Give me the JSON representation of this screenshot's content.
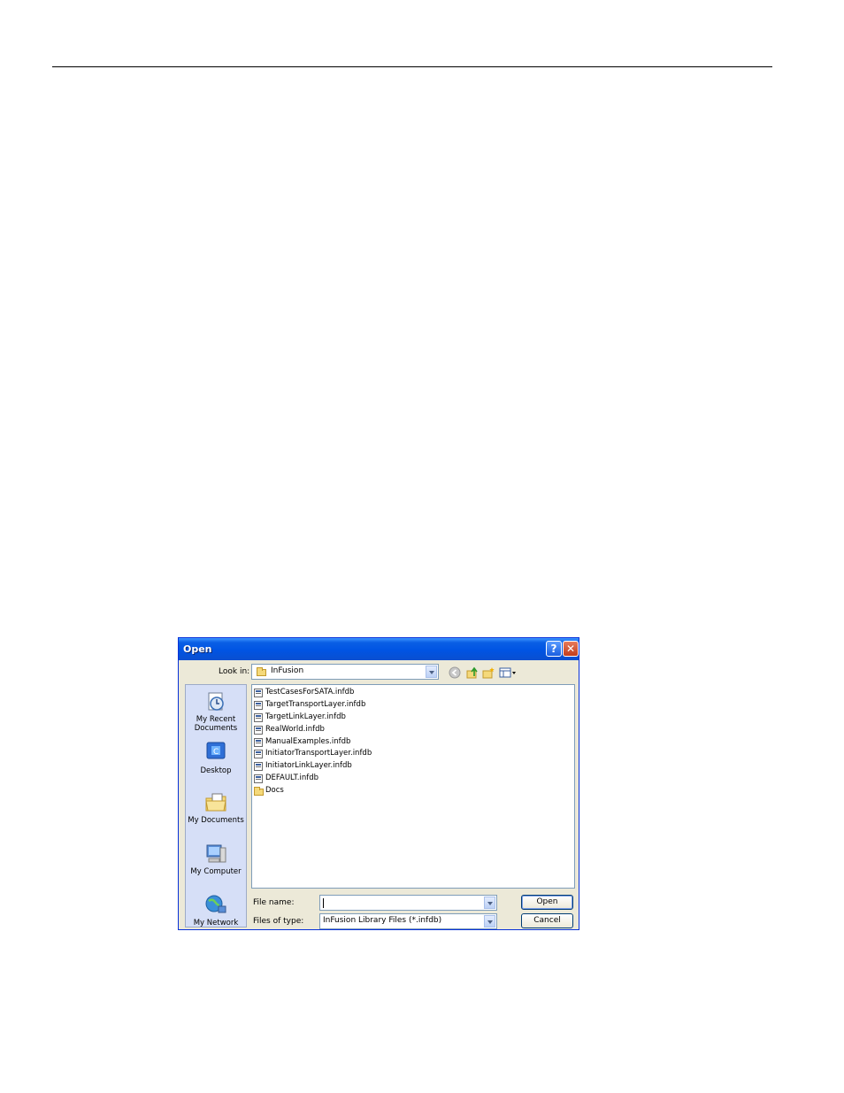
{
  "dialog": {
    "title": "Open",
    "help_label": "?",
    "close_label": "✕"
  },
  "lookin": {
    "label": "Look in:",
    "value": "InFusion"
  },
  "toolbar": {
    "icons": [
      "back-icon",
      "up-folder-icon",
      "new-folder-icon",
      "views-menu-icon"
    ]
  },
  "places": [
    {
      "label": "My Recent\nDocuments",
      "icon": "recent-documents-icon"
    },
    {
      "label": "Desktop",
      "icon": "desktop-icon"
    },
    {
      "label": "My Documents",
      "icon": "my-documents-icon"
    },
    {
      "label": "My Computer",
      "icon": "my-computer-icon"
    },
    {
      "label": "My Network",
      "icon": "my-network-icon"
    }
  ],
  "files": [
    {
      "name": "TestCasesForSATA.infdb",
      "type": "file"
    },
    {
      "name": "TargetTransportLayer.infdb",
      "type": "file"
    },
    {
      "name": "TargetLinkLayer.infdb",
      "type": "file"
    },
    {
      "name": "RealWorld.infdb",
      "type": "file"
    },
    {
      "name": "ManualExamples.infdb",
      "type": "file"
    },
    {
      "name": "InitiatorTransportLayer.infdb",
      "type": "file"
    },
    {
      "name": "InitiatorLinkLayer.infdb",
      "type": "file"
    },
    {
      "name": "DEFAULT.infdb",
      "type": "file"
    },
    {
      "name": "Docs",
      "type": "folder"
    }
  ],
  "filename": {
    "label": "File name:",
    "value": ""
  },
  "filetype": {
    "label": "Files of type:",
    "value": "InFusion Library Files (*.infdb)"
  },
  "buttons": {
    "open": "Open",
    "cancel": "Cancel"
  }
}
